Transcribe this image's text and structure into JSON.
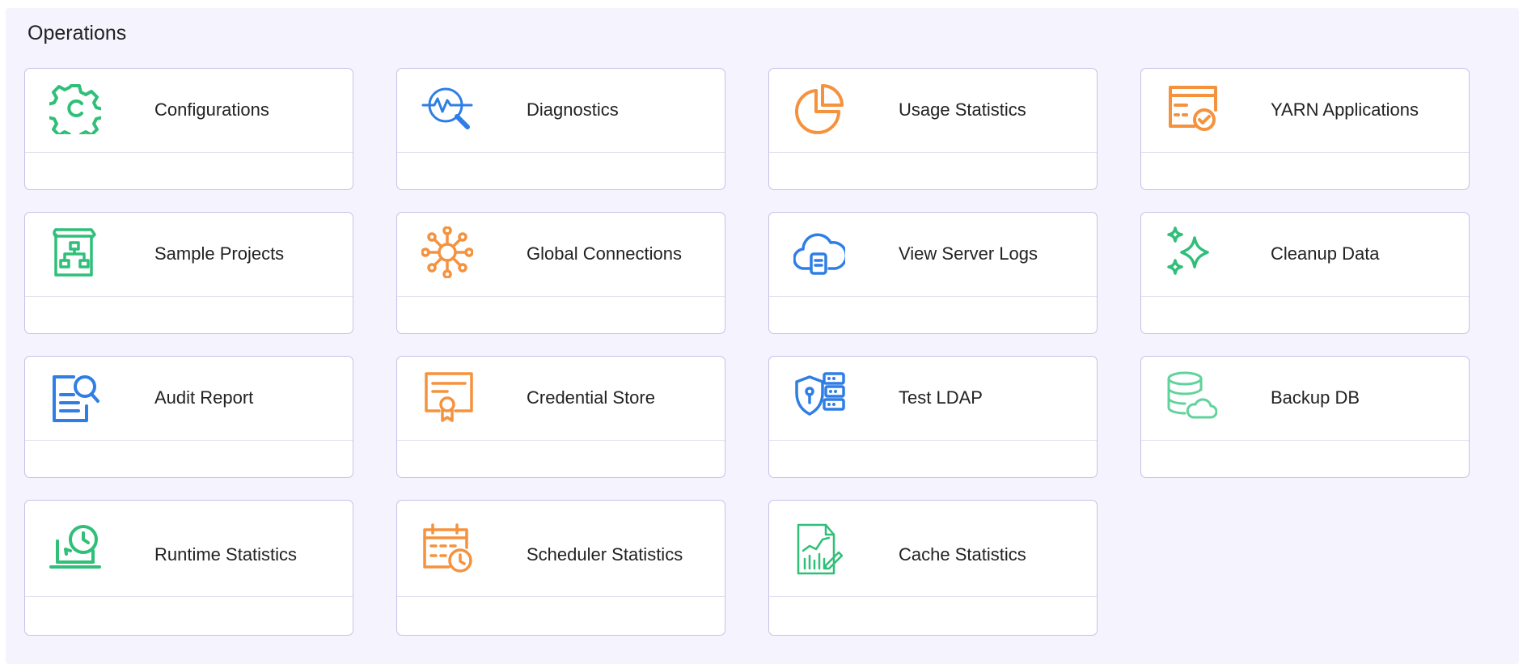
{
  "section": {
    "title": "Operations"
  },
  "colors": {
    "green": "#2fbf78",
    "orange": "#f5923e",
    "blue": "#2f7ee6",
    "light_green": "#5fd39b"
  },
  "cards": [
    {
      "label": "Configurations",
      "icon": "gear-icon"
    },
    {
      "label": "Diagnostics",
      "icon": "magnifier-pulse-icon"
    },
    {
      "label": "Usage Statistics",
      "icon": "pie-chart-icon"
    },
    {
      "label": "YARN Applications",
      "icon": "browser-check-icon"
    },
    {
      "label": "Sample Projects",
      "icon": "sitemap-document-icon"
    },
    {
      "label": "Global Connections",
      "icon": "network-hub-icon"
    },
    {
      "label": "View Server Logs",
      "icon": "cloud-document-icon"
    },
    {
      "label": "Cleanup Data",
      "icon": "sparkles-icon"
    },
    {
      "label": "Audit Report",
      "icon": "document-search-icon"
    },
    {
      "label": "Credential Store",
      "icon": "certificate-icon"
    },
    {
      "label": "Test LDAP",
      "icon": "shield-server-icon"
    },
    {
      "label": "Backup DB",
      "icon": "database-cloud-icon"
    },
    {
      "label": "Runtime Statistics",
      "icon": "laptop-clock-icon"
    },
    {
      "label": "Scheduler Statistics",
      "icon": "calendar-clock-icon"
    },
    {
      "label": "Cache Statistics",
      "icon": "report-chart-icon"
    }
  ]
}
